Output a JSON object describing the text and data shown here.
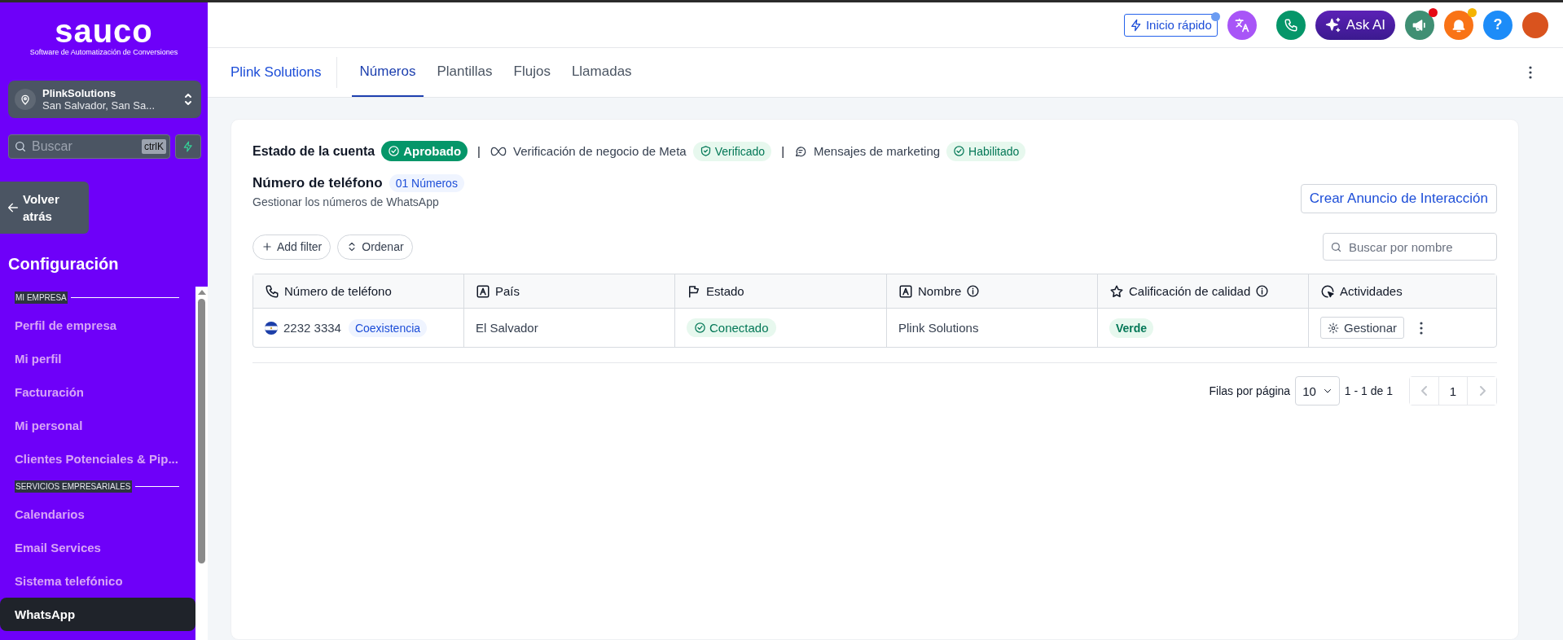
{
  "sidebar": {
    "logo": {
      "name": "sauco",
      "tagline": "Software de Automatización de Conversiones"
    },
    "account": {
      "name": "PlinkSolutions",
      "location": "San Salvador, San Sa..."
    },
    "search": {
      "placeholder": "Buscar",
      "shortcut": "ctrlK"
    },
    "back_button": "Volver atrás",
    "title": "Configuración",
    "sections": [
      {
        "heading": "MI EMPRESA",
        "items": [
          {
            "label": "Perfil de empresa",
            "selected": false
          },
          {
            "label": "Mi perfil",
            "selected": false
          },
          {
            "label": "Facturación",
            "selected": false
          },
          {
            "label": "Mi personal",
            "selected": false
          },
          {
            "label": "Clientes Potenciales & Pip...",
            "selected": false
          }
        ]
      },
      {
        "heading": "SERVICIOS EMPRESARIALES",
        "items": [
          {
            "label": "Calendarios",
            "selected": false
          },
          {
            "label": "Email Services",
            "selected": false
          },
          {
            "label": "Sistema telefónico",
            "selected": false
          },
          {
            "label": "WhatsApp",
            "selected": true
          }
        ]
      }
    ]
  },
  "top_bar": {
    "actions": [
      {
        "kind": "quickstart",
        "label": "Inicio rápido",
        "color": "#6b9cf2"
      },
      {
        "kind": "translate"
      },
      {
        "kind": "phone"
      },
      {
        "kind": "ai",
        "label": "Ask AI"
      },
      {
        "kind": "megaphone",
        "color": "#e50914"
      },
      {
        "kind": "bell",
        "color": "#f5b400"
      },
      {
        "kind": "help",
        "label": "?"
      },
      {
        "kind": "avatar"
      }
    ]
  },
  "tabs_bar": {
    "title": "Plink Solutions",
    "tabs": [
      {
        "label": "Números",
        "selected": true
      },
      {
        "label": "Plantillas",
        "selected": false
      },
      {
        "label": "Flujos",
        "selected": false
      },
      {
        "label": "Llamadas",
        "selected": false
      }
    ]
  },
  "account_status": [
    {
      "label": "Estado de la cuenta",
      "badge": "Aprobado",
      "kind": "solid"
    },
    {
      "separator": "|",
      "label": "Verificación de negocio de Meta",
      "badge": "Verificado",
      "kind": "shield"
    },
    {
      "separator": "|",
      "label": "Mensajes de marketing",
      "badge": "Habilitado",
      "kind": "check"
    }
  ],
  "numbers": {
    "title": "Número de teléfono",
    "count": "01 Números",
    "subtitle": "Gestionar los números de WhatsApp",
    "create_button": "Crear Anuncio de Interacción",
    "filters": [
      "Add filter",
      "Ordenar"
    ],
    "search": {
      "placeholder": "Buscar por nombre"
    }
  },
  "table": {
    "columns": [
      {
        "label": "Número de teléfono",
        "kind": "phone",
        "info": false
      },
      {
        "label": "País",
        "kind": "field",
        "info": false
      },
      {
        "label": "Estado",
        "kind": "flag",
        "info": false
      },
      {
        "label": "Nombre",
        "kind": "field",
        "info": true
      },
      {
        "label": "Calificación de calidad",
        "kind": "star",
        "info": true
      },
      {
        "label": "Actividades",
        "kind": "activity",
        "info": false
      }
    ],
    "rows": [
      {
        "number": "2232 3334",
        "tag": "Coexistencia",
        "country": "El Salvador",
        "status": "Conectado",
        "name": "Plink Solutions",
        "quality": "Verde",
        "action": "Gestionar"
      }
    ]
  },
  "pagination": {
    "rows_label": "Filas por página",
    "rows_per_page": "10",
    "range": "1 - 1 de 1",
    "page": "1"
  }
}
